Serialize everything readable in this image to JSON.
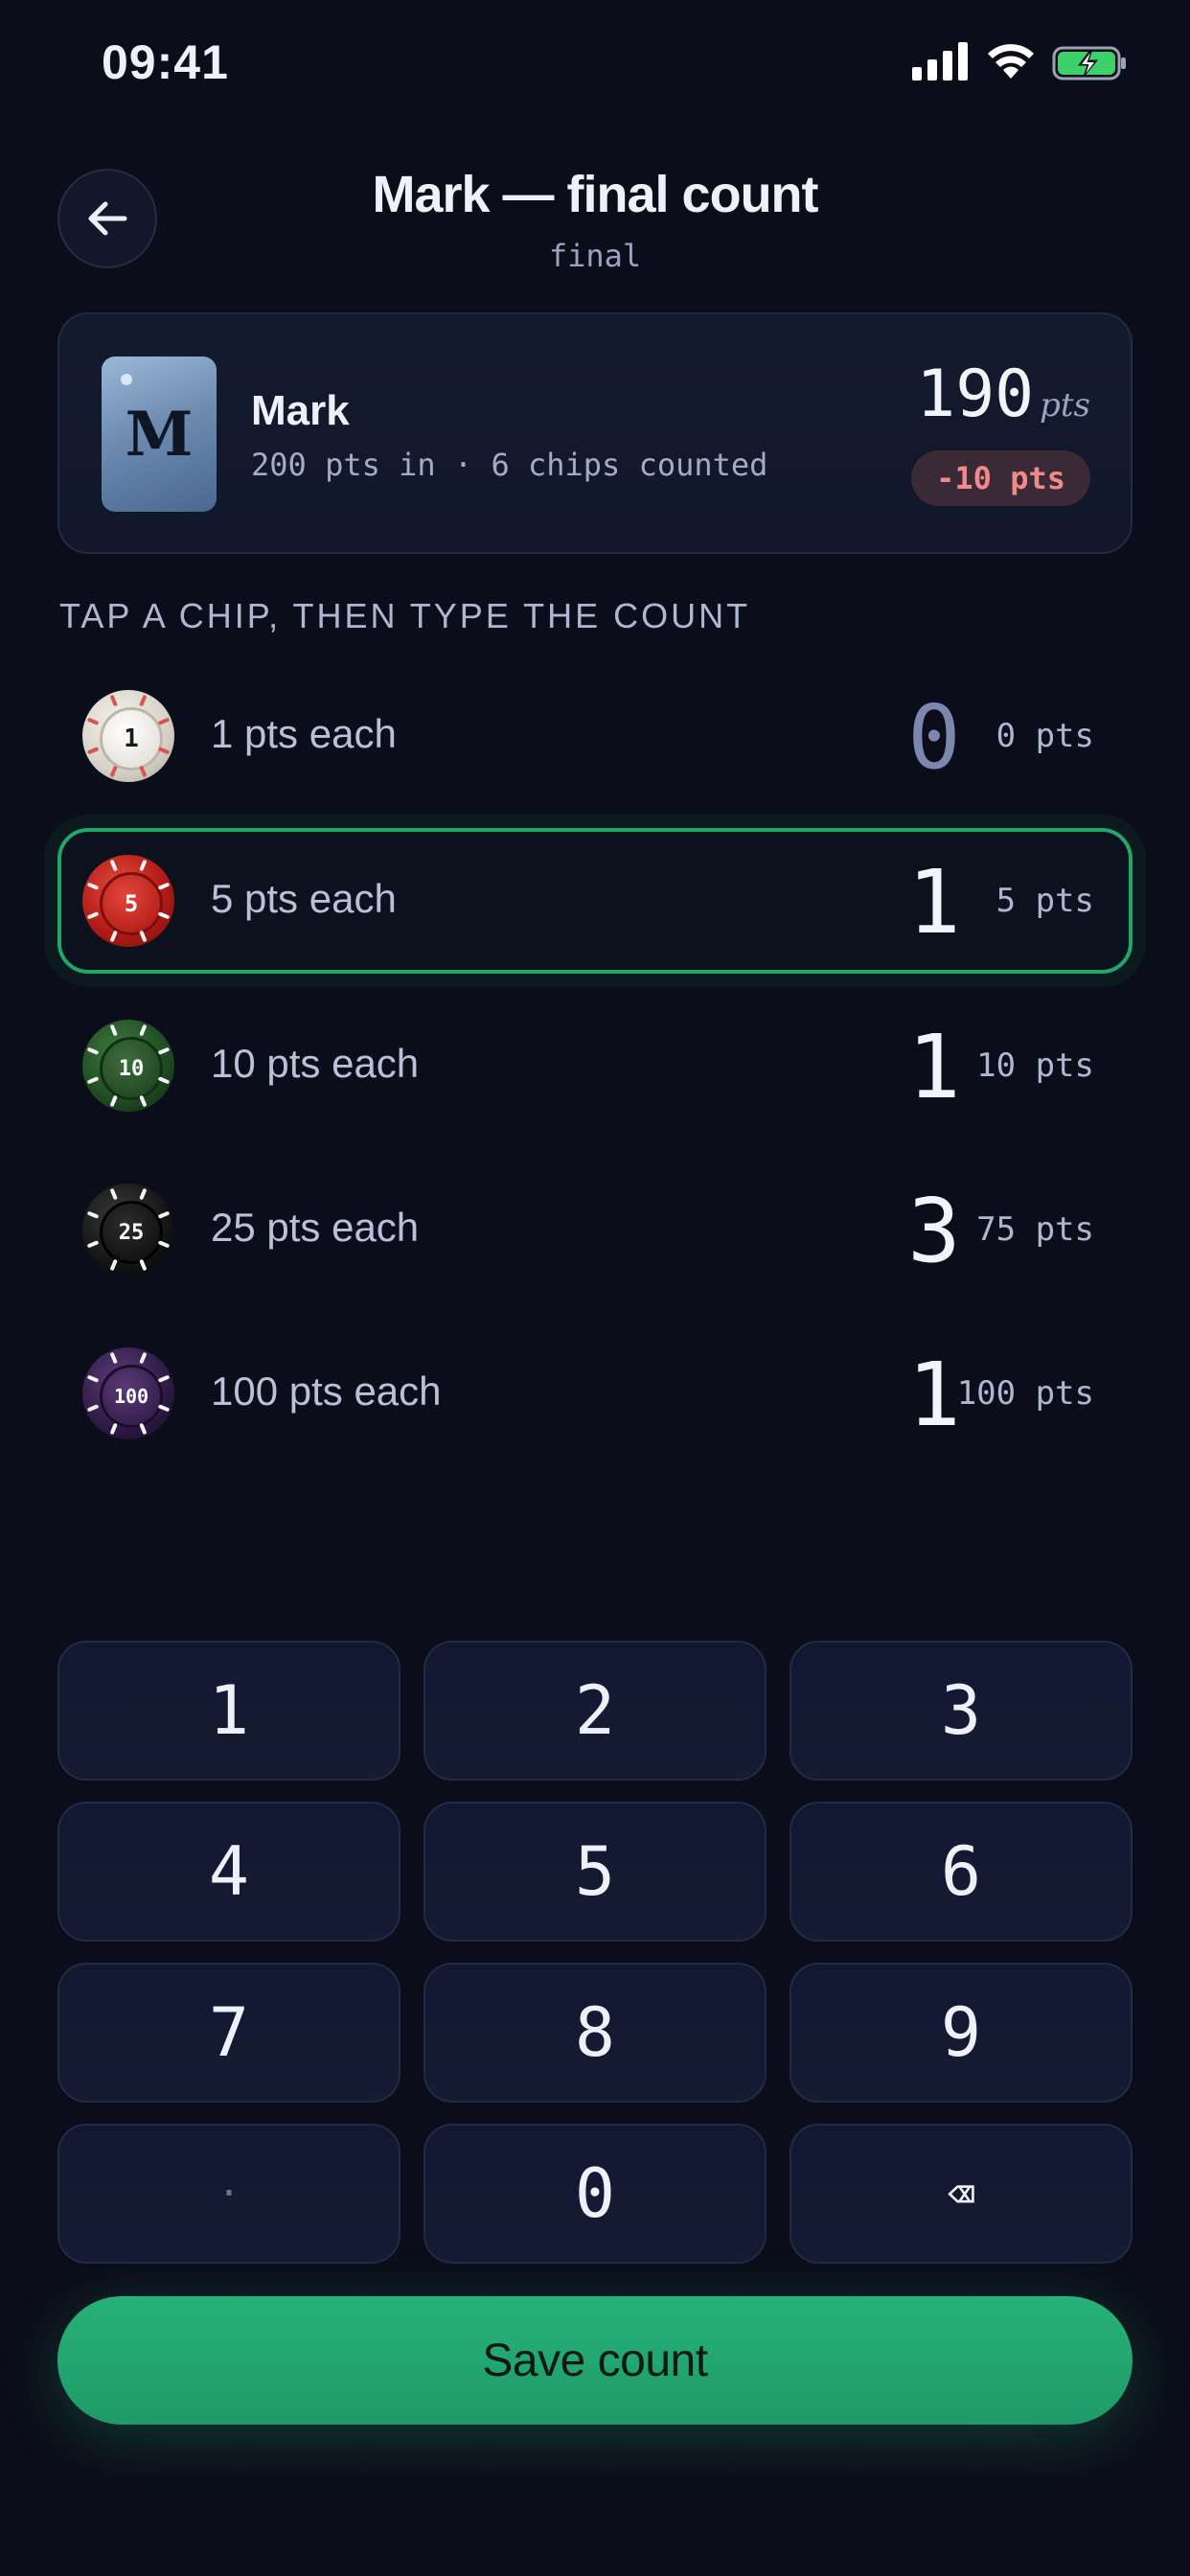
{
  "status_bar": {
    "time": "09:41"
  },
  "header": {
    "title": "Mark — final count",
    "subtitle": "final"
  },
  "player": {
    "initial": "M",
    "name": "Mark",
    "meta": "200 pts in · 6 chips counted",
    "total": "190",
    "total_unit": "pts",
    "diff": "-10 pts"
  },
  "instructions": "TAP A CHIP, THEN TYPE THE COUNT",
  "chips": [
    {
      "chip_label": "1",
      "label": "1 pts each",
      "count": "0",
      "pts": "0 pts",
      "color": "#d9d6cf"
    },
    {
      "chip_label": "5",
      "label": "5 pts each",
      "count": "1",
      "pts": "5 pts",
      "color": "#c0201c",
      "selected": true
    },
    {
      "chip_label": "10",
      "label": "10 pts each",
      "count": "1",
      "pts": "10 pts",
      "color": "#1f4a22"
    },
    {
      "chip_label": "25",
      "label": "25 pts each",
      "count": "3",
      "pts": "75 pts",
      "color": "#121212"
    },
    {
      "chip_label": "100",
      "label": "100 pts each",
      "count": "1",
      "pts": "100 pts",
      "color": "#3c2354"
    }
  ],
  "keypad": {
    "keys": [
      "1",
      "2",
      "3",
      "4",
      "5",
      "6",
      "7",
      "8",
      "9",
      "·",
      "0",
      "⌫"
    ]
  },
  "save_label": "Save count",
  "colors": {
    "accent": "#23a66a",
    "danger": "#f08a8a",
    "background": "#0b0e1a"
  }
}
